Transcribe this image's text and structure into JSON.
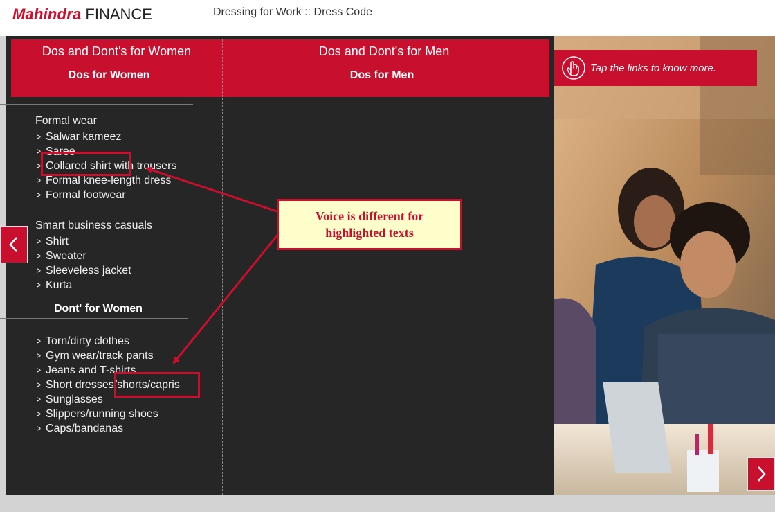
{
  "header": {
    "brand_primary": "Mahindra",
    "brand_secondary": "FINANCE",
    "course_title": "Dressing for Work :: Dress Code"
  },
  "tabs": {
    "women": {
      "title": "Dos and Dont's for Women",
      "subtitle": "Dos for Women"
    },
    "men": {
      "title": "Dos and Dont's for Men",
      "subtitle": "Dos for Men"
    }
  },
  "women": {
    "formal_heading": "Formal wear",
    "formal_items": [
      "Salwar kameez",
      "Saree",
      "Collared shirt with trousers",
      "Formal knee-length dress",
      "Formal footwear"
    ],
    "casual_heading": "Smart business casuals",
    "casual_items": [
      "Shirt",
      "Sweater",
      "Sleeveless jacket",
      "Kurta"
    ],
    "dont_heading": "Dont' for Women",
    "dont_items": [
      "Torn/dirty clothes",
      "Gym wear/track pants",
      "Jeans and T-shirts",
      "Short dresses/shorts/capris",
      "Sunglasses",
      "Slippers/running shoes",
      "Caps/bandanas"
    ]
  },
  "callout": {
    "line1": "Voice is different for",
    "line2": "highlighted texts"
  },
  "tap_banner": {
    "text": "Tap the links to know more."
  },
  "nav": {
    "prev_icon": "chevron-left-icon",
    "next_icon": "chevron-right-icon"
  },
  "colors": {
    "accent": "#c8102e",
    "panel": "#262626",
    "callout_bg": "#ffffcc"
  }
}
